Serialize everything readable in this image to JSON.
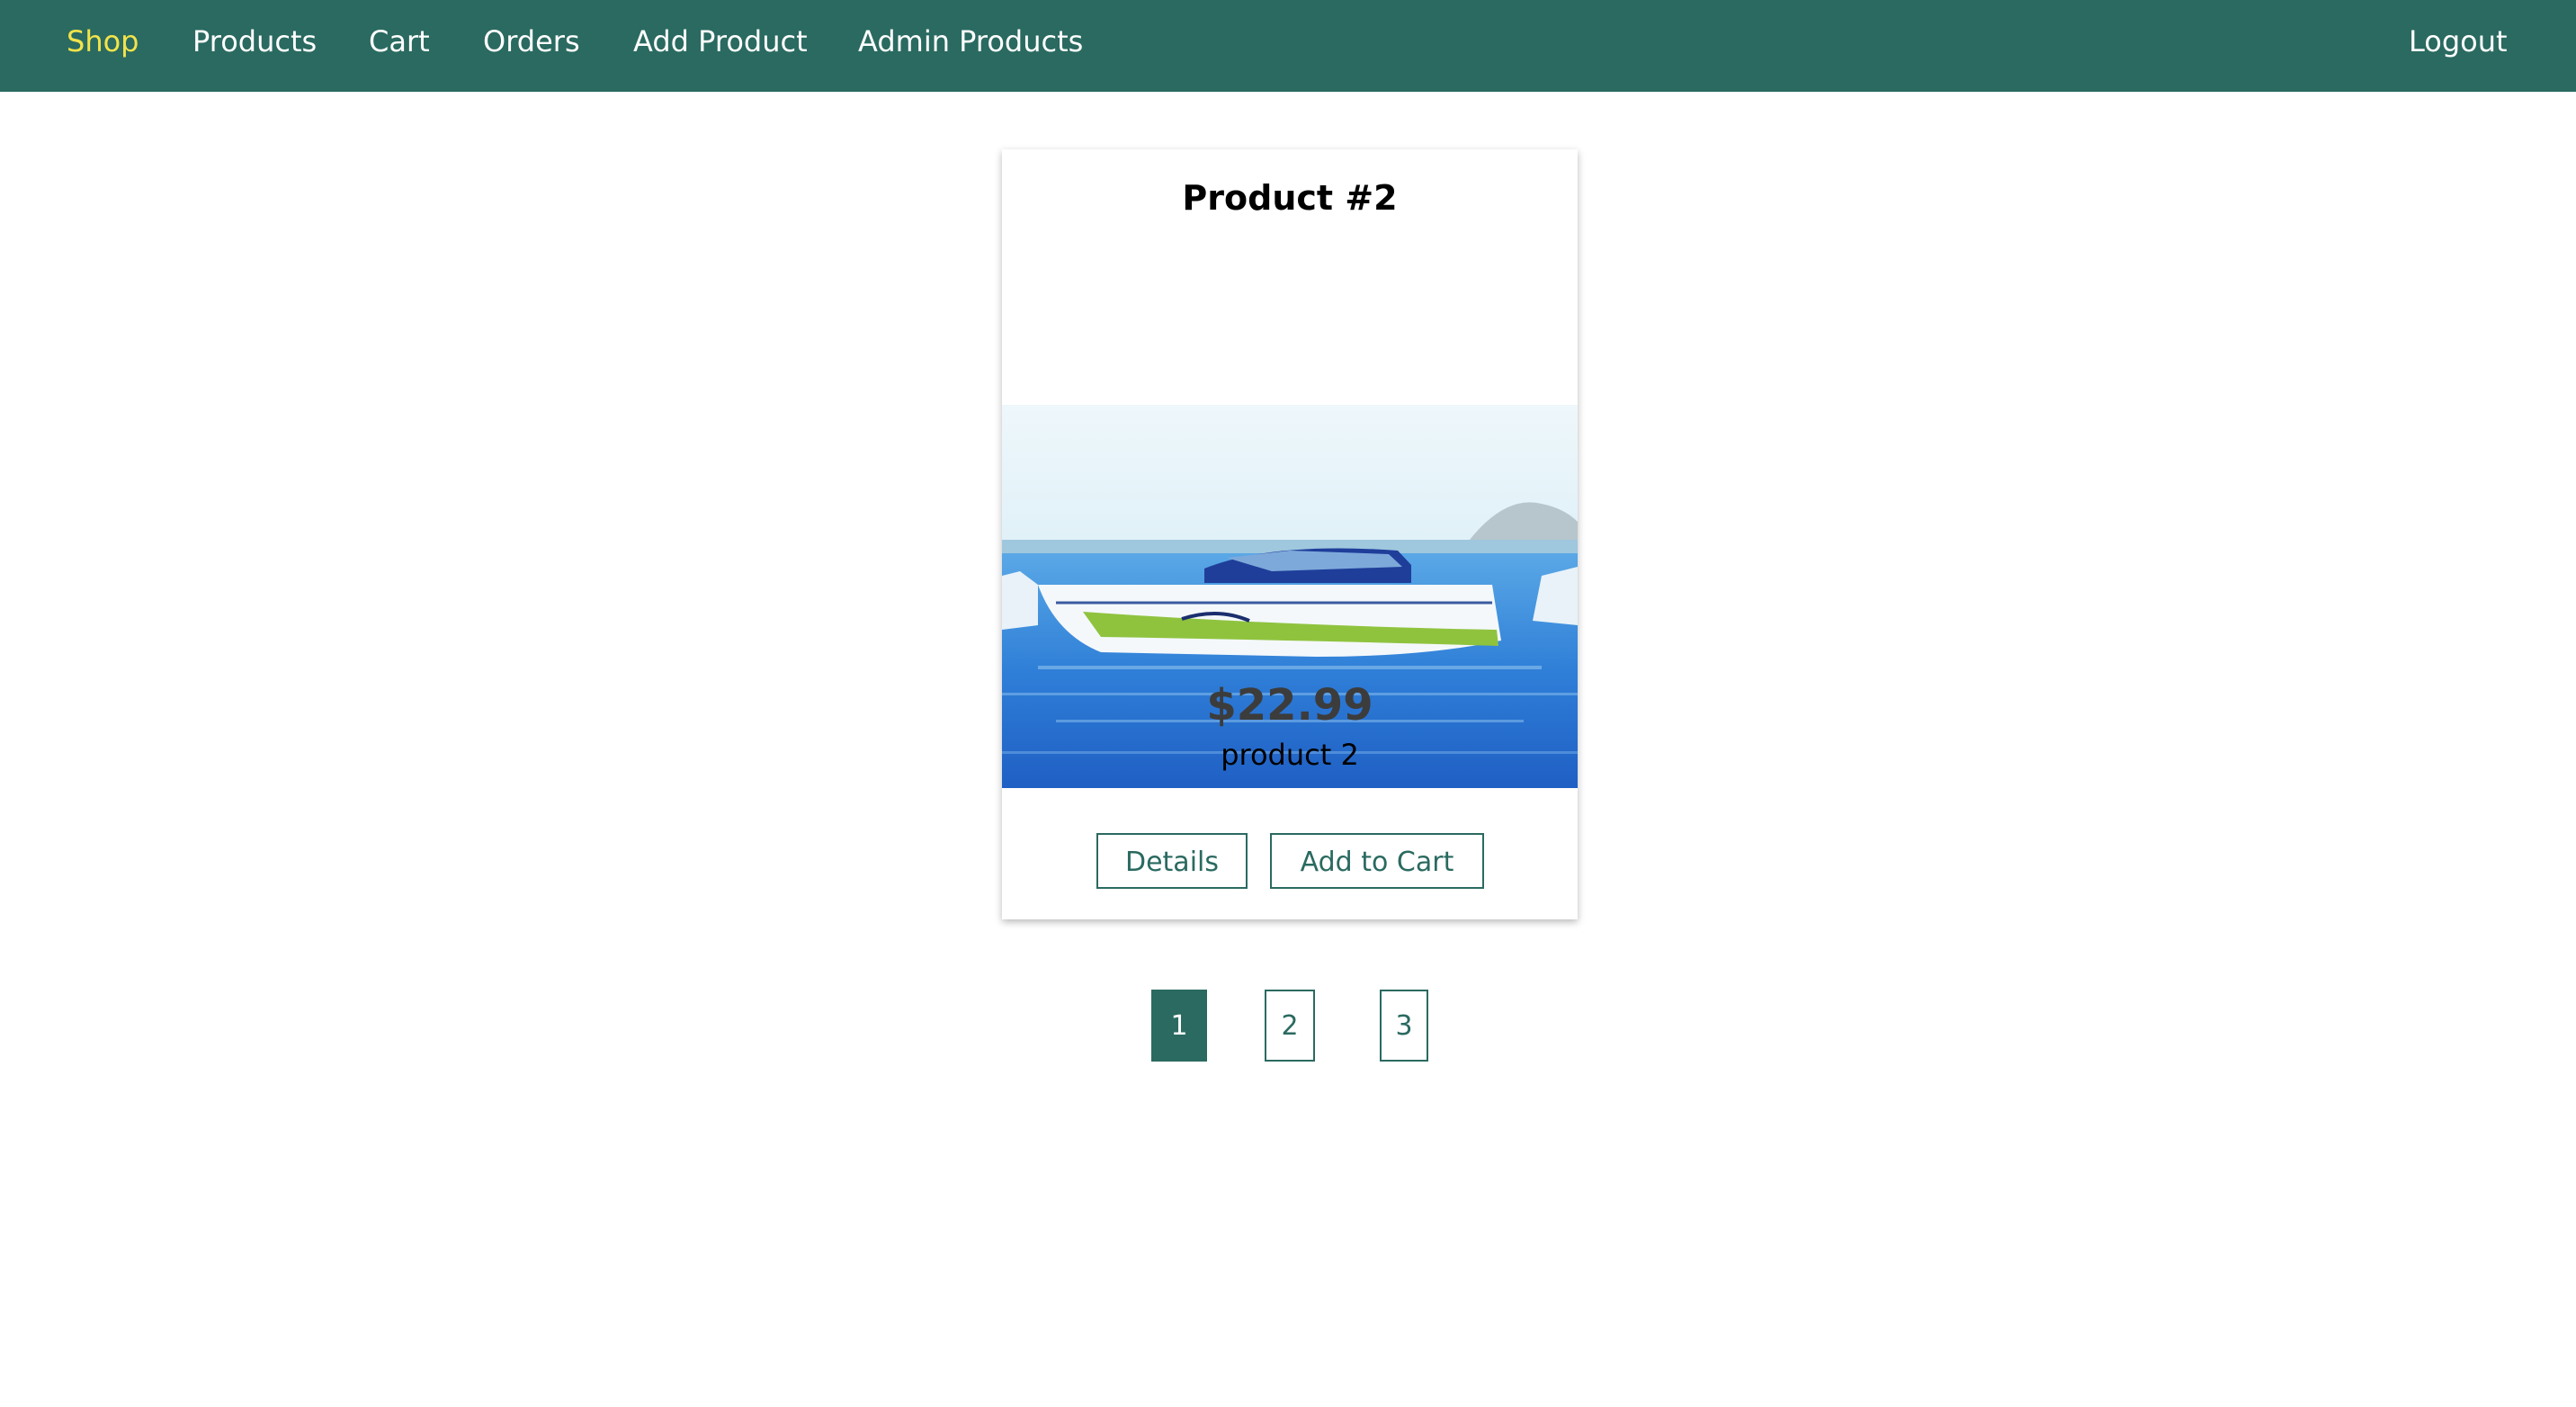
{
  "nav": {
    "items": [
      {
        "label": "Shop",
        "active": true
      },
      {
        "label": "Products"
      },
      {
        "label": "Cart"
      },
      {
        "label": "Orders"
      },
      {
        "label": "Add Product"
      },
      {
        "label": "Admin Products"
      }
    ],
    "logout": "Logout"
  },
  "product": {
    "title": "Product #2",
    "image_alt": "boat",
    "price": "$22.99",
    "description": "product 2",
    "details_label": "Details",
    "add_to_cart_label": "Add to Cart"
  },
  "pagination": {
    "pages": [
      "1",
      "2",
      "3"
    ],
    "current": "1"
  },
  "colors": {
    "header_bg": "#2a6a60",
    "active_nav": "#f2e34b",
    "accent": "#2a6a60"
  }
}
